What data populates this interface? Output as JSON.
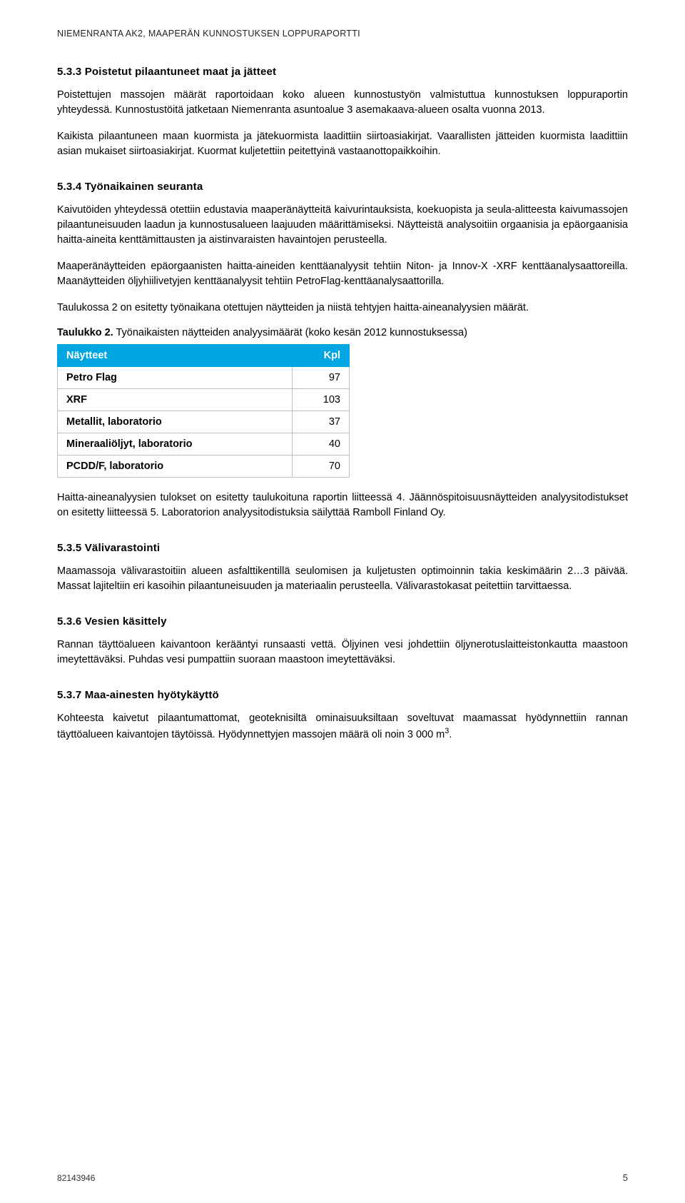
{
  "runningHeader": "NIEMENRANTA AK2, MAAPERÄN KUNNOSTUKSEN LOPPURAPORTTI",
  "s533": {
    "title": "5.3.3 Poistetut pilaantuneet maat ja jätteet",
    "p1": "Poistettujen massojen määrät raportoidaan koko alueen kunnostustyön valmistuttua kunnostuksen loppuraportin yhteydessä.",
    "p2": "Kunnostustöitä jatketaan Niemenranta asuntoalue 3 asemakaava-alueen osalta vuonna 2013.",
    "p3": "Kaikista pilaantuneen maan kuormista ja jätekuormista laadittiin siirtoasiakirjat. Vaarallisten jätteiden kuormista laadittiin asian mukaiset siirtoasiakirjat. Kuormat kuljetettiin peitettyinä vastaanottopaikkoihin."
  },
  "s534": {
    "title": "5.3.4 Työnaikainen seuranta",
    "p1": "Kaivutöiden yhteydessä otettiin edustavia maaperänäytteitä kaivurintauksista, koekuopista ja seula-alitteesta kaivumassojen pilaantuneisuuden laadun ja kunnostusalueen laajuuden määrittämiseksi. Näytteistä analysoitiin orgaanisia ja epäorgaanisia haitta-aineita kenttämittausten ja aistinvaraisten havaintojen perusteella.",
    "p2": "Maaperänäytteiden epäorgaanisten haitta-aineiden kenttäanalyysit tehtiin Niton- ja Innov-X -XRF kenttäanalysaattoreilla. Maanäytteiden öljyhiilivetyjen kenttäanalyysit tehtiin PetroFlag-kenttäanalysaattorilla.",
    "p3": "Taulukossa 2 on esitetty työnaikana otettujen näytteiden ja niistä tehtyjen haitta-aineanalyysien määrät.",
    "tableCaptionBold": "Taulukko 2.",
    "tableCaptionRest": " Työnaikaisten näytteiden analyysimäärät (koko kesän 2012 kunnostuksessa)",
    "headers": {
      "col1": "Näytteet",
      "col2": "Kpl"
    },
    "rows": [
      {
        "label": "Petro Flag",
        "value": "97"
      },
      {
        "label": "XRF",
        "value": "103"
      },
      {
        "label": "Metallit, laboratorio",
        "value": "37"
      },
      {
        "label": "Mineraaliöljyt, laboratorio",
        "value": "40"
      },
      {
        "label": "PCDD/F, laboratorio",
        "value": "70"
      }
    ],
    "p4": "Haitta-aineanalyysien tulokset on esitetty taulukoituna raportin liitteessä 4. Jäännöspitoisuusnäytteiden analyysitodistukset on esitetty liitteessä 5. Laboratorion analyysitodistuksia säilyttää Ramboll Finland Oy."
  },
  "s535": {
    "title": "5.3.5 Välivarastointi",
    "p1": "Maamassoja välivarastoitiin alueen asfalttikentillä seulomisen ja kuljetusten optimoinnin takia keskimäärin 2…3 päivää. Massat lajiteltiin eri kasoihin pilaantuneisuuden ja materiaalin perusteella. Välivarastokasat peitettiin tarvittaessa."
  },
  "s536": {
    "title": "5.3.6 Vesien käsittely",
    "p1": "Rannan täyttöalueen kaivantoon kerääntyi runsaasti vettä. Öljyinen vesi johdettiin öljynerotuslaitteistonkautta maastoon imeytettäväksi. Puhdas vesi pumpattiin suoraan maastoon imeytettäväksi."
  },
  "s537": {
    "title": "5.3.7 Maa-ainesten hyötykäyttö",
    "p1_pre": "Kohteesta kaivetut pilaantumattomat, geoteknisiltä ominaisuuksiltaan soveltuvat maamassat hyödynnettiin rannan täyttöalueen kaivantojen täytöissä. Hyödynnettyjen massojen määrä oli noin 3 000 m",
    "p1_sup": "3",
    "p1_post": "."
  },
  "footer": {
    "docnum": "82143946",
    "pagenum": "5"
  }
}
